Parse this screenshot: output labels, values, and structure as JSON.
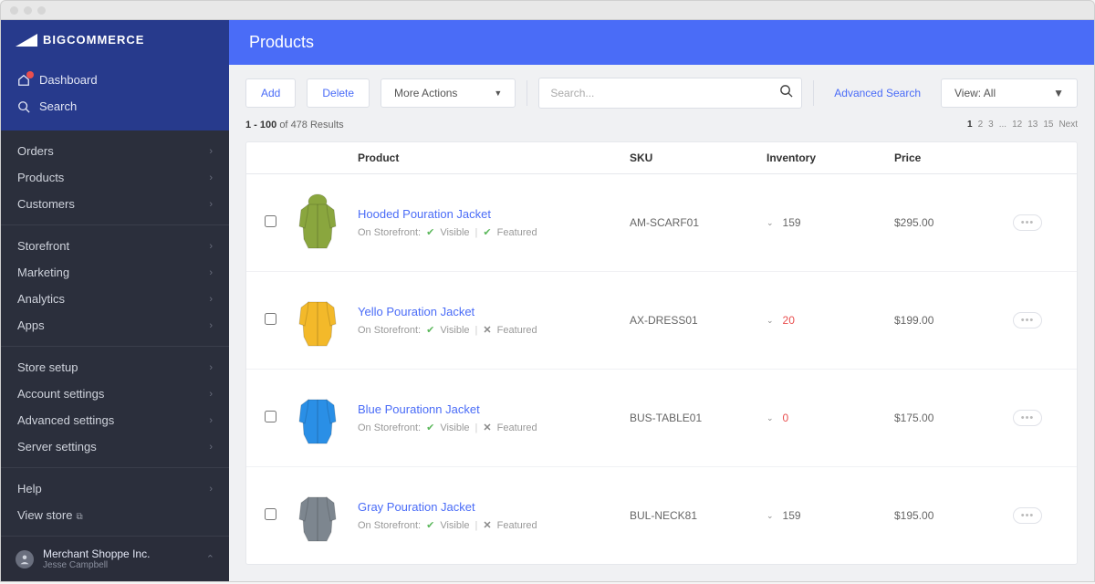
{
  "brand": {
    "prefix": "BIG",
    "suffix": "COMMERCE"
  },
  "topnav": {
    "dashboard": "Dashboard",
    "search": "Search"
  },
  "sidebar_groups": [
    [
      {
        "label": "Orders"
      },
      {
        "label": "Products"
      },
      {
        "label": "Customers"
      }
    ],
    [
      {
        "label": "Storefront"
      },
      {
        "label": "Marketing"
      },
      {
        "label": "Analytics"
      },
      {
        "label": "Apps"
      }
    ],
    [
      {
        "label": "Store setup"
      },
      {
        "label": "Account settings"
      },
      {
        "label": "Advanced settings"
      },
      {
        "label": "Server settings"
      }
    ],
    [
      {
        "label": "Help"
      },
      {
        "label": "View store",
        "external": true
      }
    ]
  ],
  "user": {
    "org": "Merchant Shoppe Inc.",
    "name": "Jesse Campbell"
  },
  "page_title": "Products",
  "toolbar": {
    "add": "Add",
    "delete": "Delete",
    "more_actions": "More Actions",
    "search_placeholder": "Search...",
    "advanced_search": "Advanced Search",
    "view_label": "View: All"
  },
  "results_meta": {
    "range": "1 - 100",
    "of_word": "of",
    "total": "478",
    "results_word": "Results"
  },
  "pagination": {
    "pages": [
      "1",
      "2",
      "3",
      "...",
      "12",
      "13",
      "15"
    ],
    "next": "Next",
    "current": 0
  },
  "columns": {
    "product": "Product",
    "sku": "SKU",
    "inventory": "Inventory",
    "price": "Price"
  },
  "row_labels": {
    "on_storefront": "On Storefront:",
    "visible": "Visible",
    "featured": "Featured"
  },
  "products": [
    {
      "name": "Hooded Pouration Jacket",
      "sku": "AM-SCARF01",
      "inventory": "159",
      "inv_low": false,
      "price": "$295.00",
      "featured": true,
      "color": "#8aa63e"
    },
    {
      "name": "Yello Pouration Jacket",
      "sku": "AX-DRESS01",
      "inventory": "20",
      "inv_low": true,
      "price": "$199.00",
      "featured": false,
      "color": "#f3b92a"
    },
    {
      "name": "Blue Pourationn Jacket",
      "sku": "BUS-TABLE01",
      "inventory": "0",
      "inv_low": true,
      "price": "$175.00",
      "featured": false,
      "color": "#2a8fe6"
    },
    {
      "name": "Gray Pouration Jacket",
      "sku": "BUL-NECK81",
      "inventory": "159",
      "inv_low": false,
      "price": "$195.00",
      "featured": false,
      "color": "#7d868f"
    }
  ]
}
